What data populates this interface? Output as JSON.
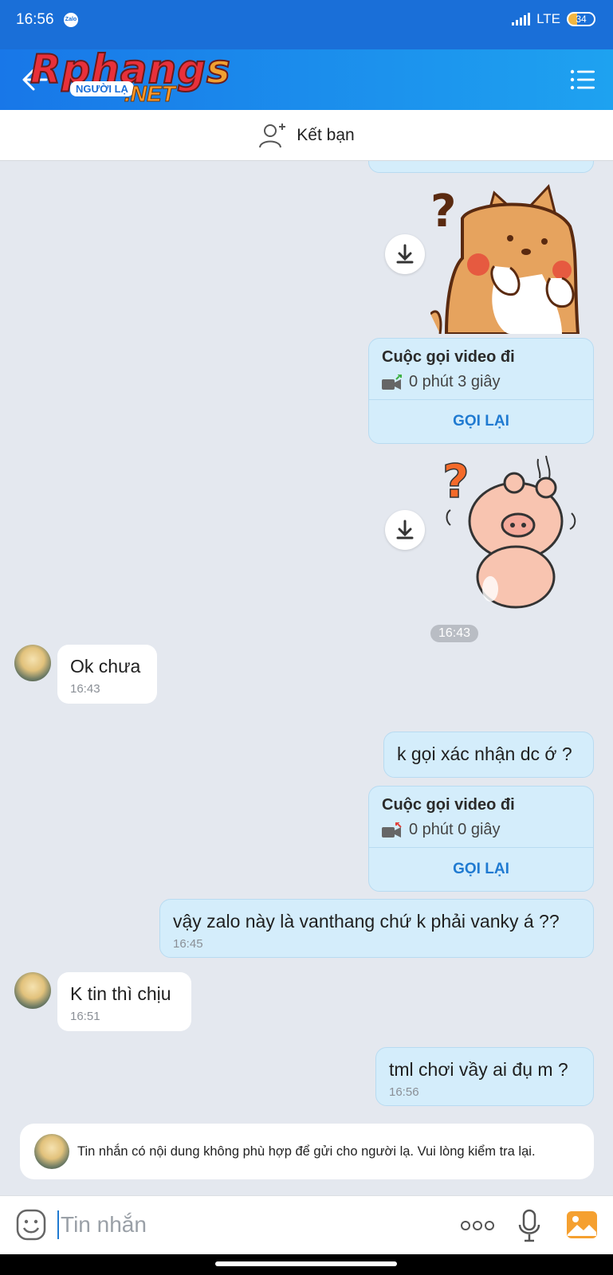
{
  "status_bar": {
    "time": "16:56",
    "app_badge": "Zalo",
    "network": "LTE",
    "network_sub": "ll",
    "battery": "34"
  },
  "header": {
    "logo_main": "Rphangs",
    "logo_badge": "NGƯỜI LẠ",
    "logo_suffix": ".NET"
  },
  "friend_bar": {
    "label": "Kết bạn"
  },
  "messages": {
    "call1": {
      "title": "Cuộc gọi video đi",
      "duration": "0 phút 3 giây",
      "action": "GỌI LẠI"
    },
    "time_pill": "16:43",
    "in1": {
      "text": "Ok chưa",
      "time": "16:43"
    },
    "out1": {
      "text": "k gọi xác nhận dc ớ ?"
    },
    "call2": {
      "title": "Cuộc gọi video đi",
      "duration": "0 phút 0 giây",
      "action": "GỌI LẠI"
    },
    "out2": {
      "text": "vậy zalo này là vanthang chứ k phải vanky á ??",
      "time": "16:45"
    },
    "in2": {
      "text": "K tin thì chịu",
      "time": "16:51"
    },
    "out3": {
      "text": "tml chơi vầy ai đụ m ?",
      "time": "16:56"
    }
  },
  "warning": {
    "text": "Tin nhắn có nội dung không phù hợp để gửi cho người lạ. Vui lòng kiểm tra lại."
  },
  "composer": {
    "placeholder": "Tin nhắn"
  },
  "icons": {
    "back": "back-arrow-icon",
    "menu": "menu-list-icon",
    "add_friend": "add-friend-icon",
    "download": "download-icon",
    "video_call": "video-call-icon",
    "emoji": "emoji-icon",
    "more": "more-icon",
    "mic": "microphone-icon",
    "image": "image-icon"
  },
  "colors": {
    "header": "#1877e8",
    "bubble_out": "#d4edfb",
    "bubble_in": "#ffffff",
    "chat_bg": "#e4e8ef",
    "accent": "#1f7ad1"
  }
}
